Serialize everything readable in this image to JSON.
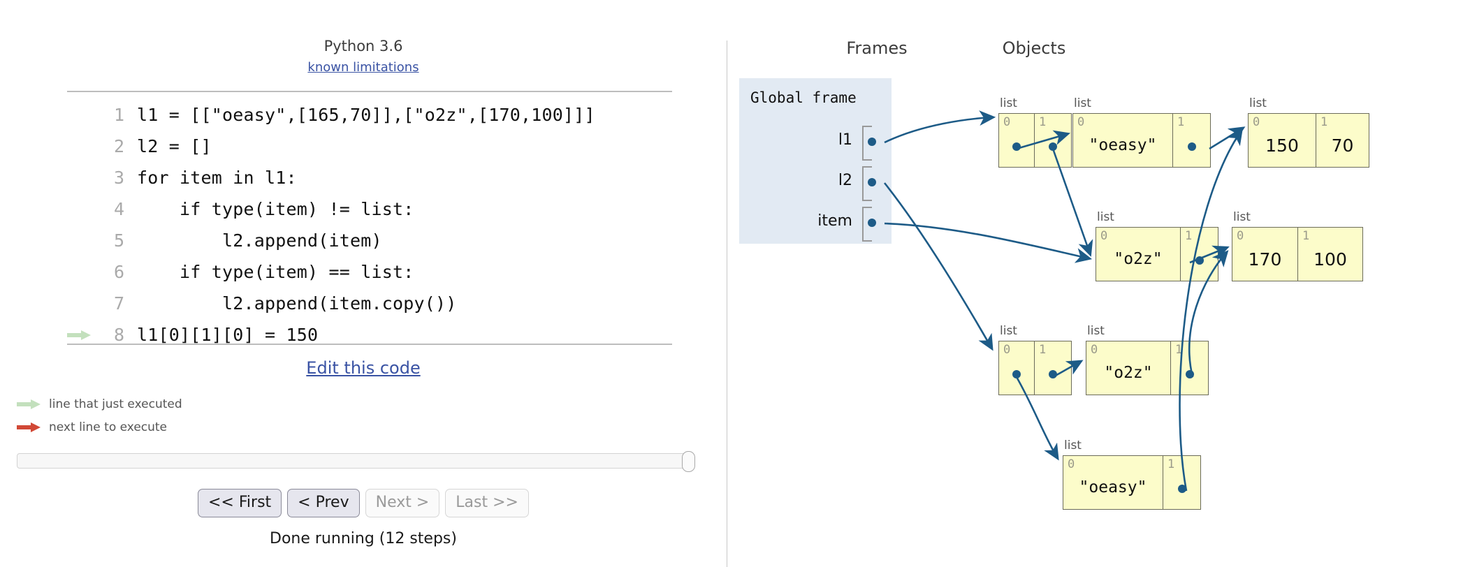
{
  "left": {
    "python_version": "Python 3.6",
    "known_limitations_link": "known limitations",
    "edit_code_link": "Edit this code",
    "code_lines": [
      {
        "num": "1",
        "text": "l1 = [[\"oeasy\",[165,70]],[\"o2z\",[170,100]]]",
        "marker": ""
      },
      {
        "num": "2",
        "text": "l2 = []",
        "marker": ""
      },
      {
        "num": "3",
        "text": "for item in l1:",
        "marker": ""
      },
      {
        "num": "4",
        "text": "    if type(item) != list:",
        "marker": ""
      },
      {
        "num": "5",
        "text": "        l2.append(item)",
        "marker": ""
      },
      {
        "num": "6",
        "text": "    if type(item) == list:",
        "marker": ""
      },
      {
        "num": "7",
        "text": "        l2.append(item.copy())",
        "marker": ""
      },
      {
        "num": "8",
        "text": "l1[0][1][0] = 150",
        "marker": "green"
      }
    ],
    "legend": {
      "executed": "line that just executed",
      "next": "next line to execute"
    },
    "buttons": [
      {
        "label": "<< First",
        "state": "enabled"
      },
      {
        "label": "< Prev",
        "state": "enabled"
      },
      {
        "label": "Next >",
        "state": "disabled"
      },
      {
        "label": "Last >>",
        "state": "disabled"
      }
    ],
    "status": "Done running (12 steps)"
  },
  "right": {
    "frames_header": "Frames",
    "objects_header": "Objects",
    "global_frame": {
      "title": "Global frame",
      "variables": [
        {
          "name": "l1"
        },
        {
          "name": "l2"
        },
        {
          "name": "item"
        }
      ]
    },
    "objects": [
      {
        "id": "l1-root",
        "type": "list",
        "cells": [
          {
            "idx": "0",
            "kind": "ref"
          },
          {
            "idx": "1",
            "kind": "ref"
          }
        ]
      },
      {
        "id": "l1-0",
        "type": "list",
        "cells": [
          {
            "idx": "0",
            "kind": "str",
            "value": "\"oeasy\""
          },
          {
            "idx": "1",
            "kind": "ref"
          }
        ]
      },
      {
        "id": "l1-0-1",
        "type": "list",
        "cells": [
          {
            "idx": "0",
            "kind": "num",
            "value": "150"
          },
          {
            "idx": "1",
            "kind": "num",
            "value": "70"
          }
        ]
      },
      {
        "id": "l1-1",
        "type": "list",
        "cells": [
          {
            "idx": "0",
            "kind": "str",
            "value": "\"o2z\""
          },
          {
            "idx": "1",
            "kind": "ref"
          }
        ]
      },
      {
        "id": "l1-1-1",
        "type": "list",
        "cells": [
          {
            "idx": "0",
            "kind": "num",
            "value": "170"
          },
          {
            "idx": "1",
            "kind": "num",
            "value": "100"
          }
        ]
      },
      {
        "id": "l2-root",
        "type": "list",
        "cells": [
          {
            "idx": "0",
            "kind": "ref"
          },
          {
            "idx": "1",
            "kind": "ref"
          }
        ]
      },
      {
        "id": "l2-1-copy",
        "type": "list",
        "cells": [
          {
            "idx": "0",
            "kind": "str",
            "value": "\"o2z\""
          },
          {
            "idx": "1",
            "kind": "ref"
          }
        ]
      },
      {
        "id": "l2-0-copy",
        "type": "list",
        "cells": [
          {
            "idx": "0",
            "kind": "str",
            "value": "\"oeasy\""
          },
          {
            "idx": "1",
            "kind": "ref"
          }
        ]
      }
    ]
  },
  "colors": {
    "pointer": "#1d5b87",
    "object_fill": "#fcfcca",
    "object_border": "#6b6b5a",
    "frame_fill": "#e2eaf3",
    "link": "#3a53a4",
    "executed_arrow": "#c3e0bd",
    "next_arrow": "#d14836"
  }
}
